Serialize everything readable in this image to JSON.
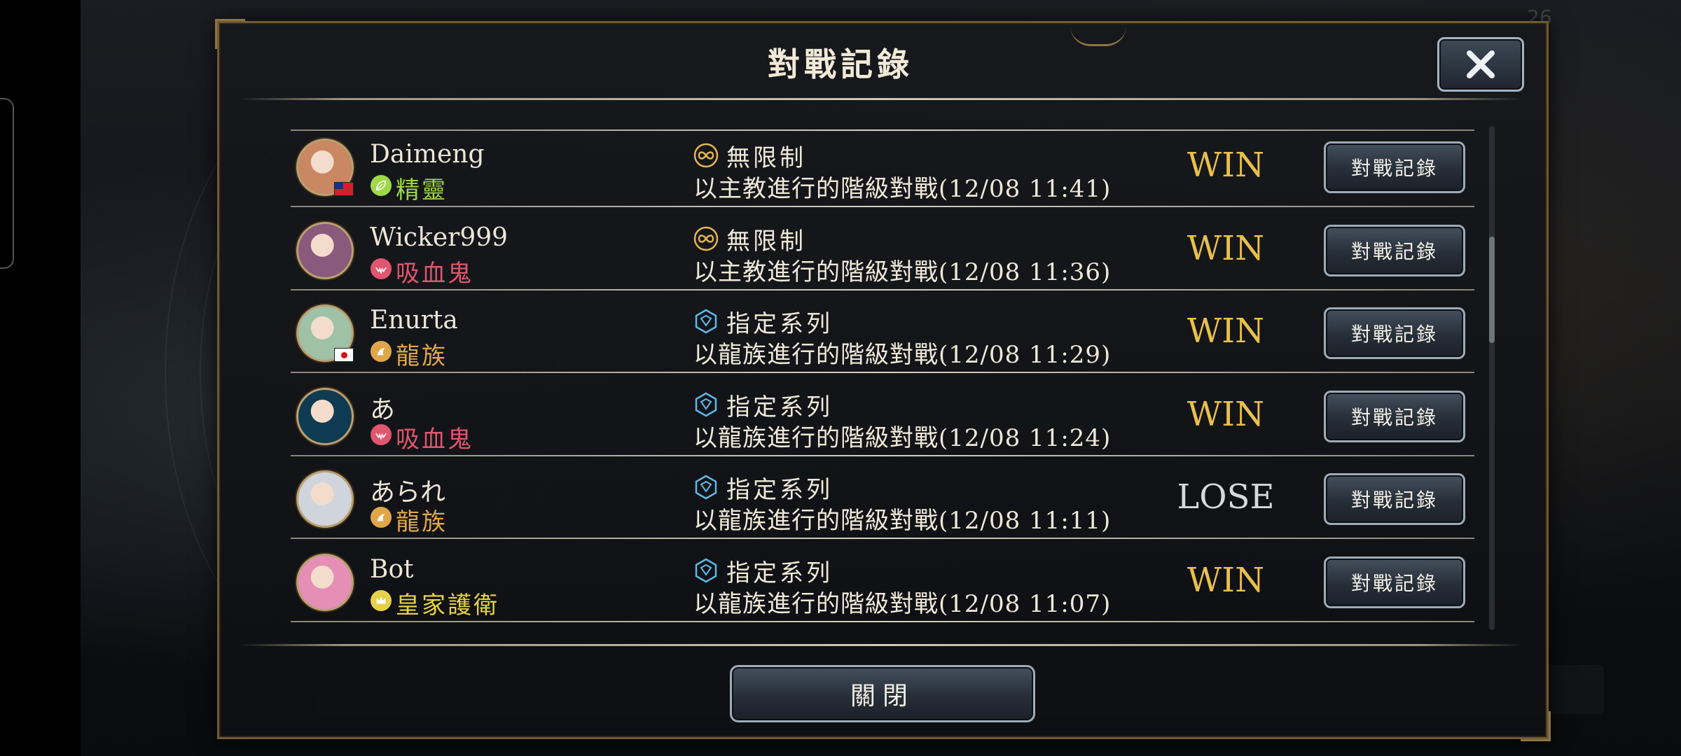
{
  "background": {
    "counter": "26"
  },
  "dialog": {
    "title": "對戰記錄",
    "close_button_label": "關閉"
  },
  "matches": [
    {
      "player": "Daimeng",
      "class": "精靈",
      "class_icon": "leaf-icon",
      "class_color": "#9fd94a",
      "avatar_color": "#c98762",
      "flag": "taiwan-flag",
      "mode": "無限制",
      "mode_icon": "infinity-icon",
      "description": "以主教進行的階級對戰(12/08 11:41)",
      "result": "WIN",
      "replay_label": "對戰記錄"
    },
    {
      "player": "Wicker999",
      "class": "吸血鬼",
      "class_icon": "bat-wing-icon",
      "class_color": "#e0566e",
      "avatar_color": "#8a5a7d",
      "flag": "",
      "mode": "無限制",
      "mode_icon": "infinity-icon",
      "description": "以主教進行的階級對戰(12/08 11:36)",
      "result": "WIN",
      "replay_label": "對戰記錄"
    },
    {
      "player": "Enurta",
      "class": "龍族",
      "class_icon": "dragon-icon",
      "class_color": "#e0a74a",
      "avatar_color": "#9fc1a6",
      "flag": "japan-flag",
      "mode": "指定系列",
      "mode_icon": "rotation-gem-icon",
      "description": "以龍族進行的階級對戰(12/08 11:29)",
      "result": "WIN",
      "replay_label": "對戰記錄"
    },
    {
      "player": "あ",
      "class": "吸血鬼",
      "class_icon": "bat-wing-icon",
      "class_color": "#e0566e",
      "avatar_color": "#0f3b52",
      "flag": "",
      "mode": "指定系列",
      "mode_icon": "rotation-gem-icon",
      "description": "以龍族進行的階級對戰(12/08 11:24)",
      "result": "WIN",
      "replay_label": "對戰記錄"
    },
    {
      "player": "あられ",
      "class": "龍族",
      "class_icon": "dragon-icon",
      "class_color": "#e0a74a",
      "avatar_color": "#d0d4dc",
      "flag": "",
      "mode": "指定系列",
      "mode_icon": "rotation-gem-icon",
      "description": "以龍族進行的階級對戰(12/08 11:11)",
      "result": "LOSE",
      "replay_label": "對戰記錄"
    },
    {
      "player": "Bot",
      "class": "皇家護衛",
      "class_icon": "crown-icon",
      "class_color": "#e6d24a",
      "avatar_color": "#e58fb6",
      "flag": "",
      "mode": "指定系列",
      "mode_icon": "rotation-gem-icon",
      "description": "以龍族進行的階級對戰(12/08 11:07)",
      "result": "WIN",
      "replay_label": "對戰記錄"
    }
  ],
  "scroll": {
    "thumb_fraction_start": 0.22,
    "thumb_fraction_size": 0.21
  }
}
